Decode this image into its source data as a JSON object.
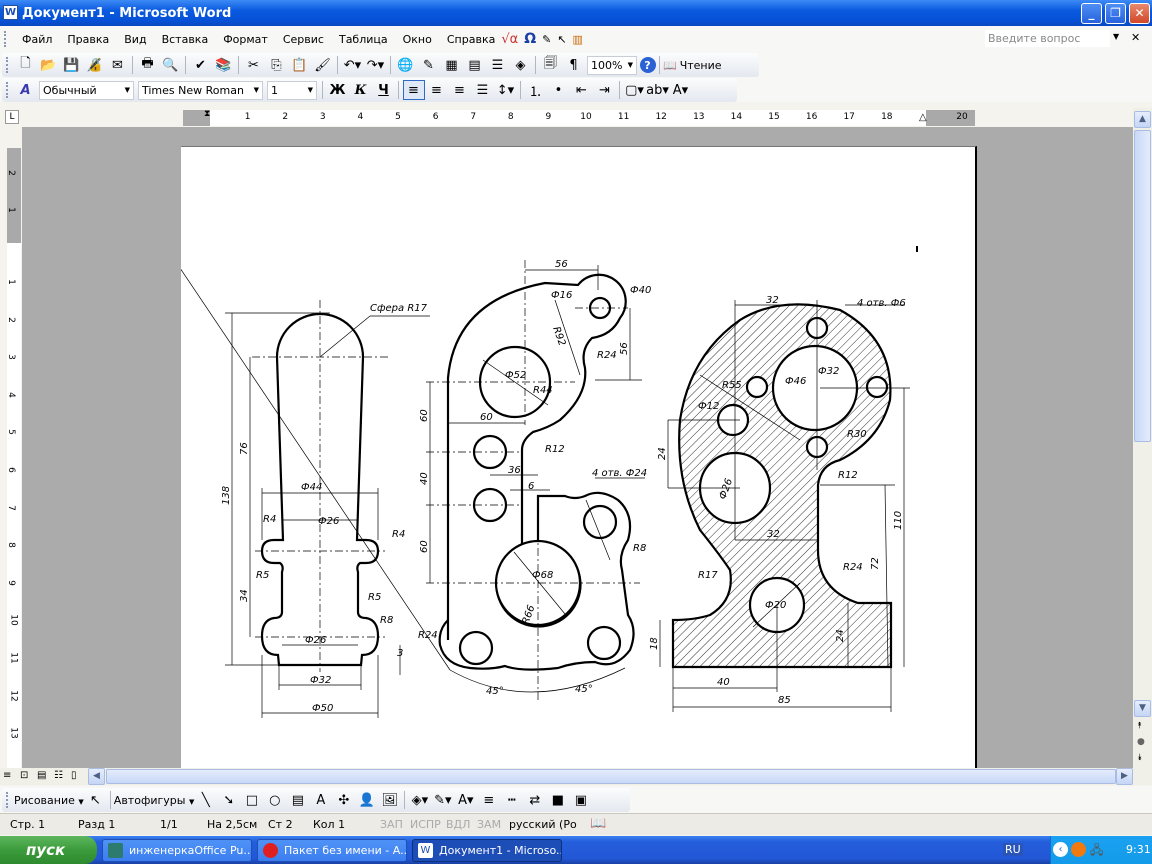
{
  "window": {
    "title": "Документ1 - Microsoft Word",
    "minimize": "_",
    "restore": "❐",
    "close": "✕"
  },
  "menu": {
    "items": [
      "Файл",
      "Правка",
      "Вид",
      "Вставка",
      "Формат",
      "Сервис",
      "Таблица",
      "Окно",
      "Справка"
    ],
    "help_placeholder": "Введите вопрос",
    "close_doc": "✕"
  },
  "standard_toolbar": {
    "zoom": "100%",
    "reading": "Чтение",
    "buttons": [
      {
        "name": "new-document-icon",
        "g": "🗋"
      },
      {
        "name": "open-icon",
        "g": "📂"
      },
      {
        "name": "save-icon",
        "g": "💾"
      },
      {
        "name": "permission-icon",
        "g": "🔏"
      },
      {
        "name": "email-icon",
        "g": "✉"
      },
      "|",
      {
        "name": "print-icon",
        "g": "🖶"
      },
      {
        "name": "print-preview-icon",
        "g": "🔍"
      },
      "|",
      {
        "name": "spelling-icon",
        "g": "✔"
      },
      {
        "name": "research-icon",
        "g": "📚"
      },
      "|",
      {
        "name": "cut-icon",
        "g": "✂"
      },
      {
        "name": "copy-icon",
        "g": "⎘"
      },
      {
        "name": "paste-icon",
        "g": "📋"
      },
      {
        "name": "format-painter-icon",
        "g": "🖌"
      },
      "|",
      {
        "name": "undo-icon",
        "g": "↶▾"
      },
      {
        "name": "redo-icon",
        "g": "↷▾"
      },
      "|",
      {
        "name": "hyperlink-icon",
        "g": "🌐"
      },
      {
        "name": "tables-borders-icon",
        "g": "✎"
      },
      {
        "name": "insert-table-icon",
        "g": "▦"
      },
      {
        "name": "insert-excel-icon",
        "g": "▤"
      },
      {
        "name": "columns-icon",
        "g": "☰"
      },
      {
        "name": "drawing-icon",
        "g": "◈"
      },
      "|",
      {
        "name": "document-map-icon",
        "g": "🗐"
      },
      {
        "name": "show-formatting-icon",
        "g": "¶"
      }
    ]
  },
  "formatting_toolbar": {
    "style": "Обычный",
    "font": "Times New Roman",
    "size": "1",
    "bold": "Ж",
    "italic": "К",
    "underline": "Ч"
  },
  "ruler": {
    "h": [
      "1",
      "2",
      "3",
      "4",
      "5",
      "6",
      "7",
      "8",
      "9",
      "10",
      "11",
      "12",
      "13",
      "14",
      "15",
      "16",
      "17",
      "18",
      "20"
    ],
    "v_top": [
      "2",
      "1"
    ],
    "v": [
      "1",
      "2",
      "3",
      "4",
      "5",
      "6",
      "7",
      "8",
      "9",
      "10",
      "11",
      "12",
      "13"
    ]
  },
  "drawing": {
    "labels": [
      "Сфера R17",
      "138",
      "76",
      "34",
      "Ф44",
      "Ф26",
      "R4",
      "R4",
      "R5",
      "R5",
      "R8",
      "Ф26",
      "3",
      "Ф32",
      "Ф50",
      "56",
      "Ф16",
      "Ф40",
      "R92",
      "R24",
      "56",
      "Ф52",
      "R44",
      "60",
      "60",
      "R12",
      "40",
      "36",
      "6",
      "4 отв. Ф24",
      "60",
      "Ф68",
      "R8",
      "R66",
      "R24",
      "45°",
      "45°",
      "32",
      "4 отв. Ф6",
      "R55",
      "Ф46",
      "Ф32",
      "Ф12",
      "R30",
      "24",
      "Ф26",
      "R12",
      "110",
      "32",
      "R24",
      "72",
      "R17",
      "Ф20",
      "18",
      "24",
      "40",
      "85"
    ]
  },
  "drawing_toolbar": {
    "drawing": "Рисование",
    "autoshapes": "Автофигуры"
  },
  "status": {
    "page": "Стр. 1",
    "section": "Разд 1",
    "pages": "1/1",
    "at": "На 2,5см",
    "line": "Ст 2",
    "col": "Кол 1",
    "rec": "ЗАП",
    "trk": "ИСПР",
    "ext": "ВДЛ",
    "ovr": "ЗАМ",
    "lang": "русский (Ро"
  },
  "taskbar": {
    "start": "пуск",
    "tasks": [
      "инженеркаOffice Pu...",
      "Пакет без имени - A...",
      "Документ1 - Microso..."
    ],
    "lang": "RU",
    "clock": "9:31"
  }
}
